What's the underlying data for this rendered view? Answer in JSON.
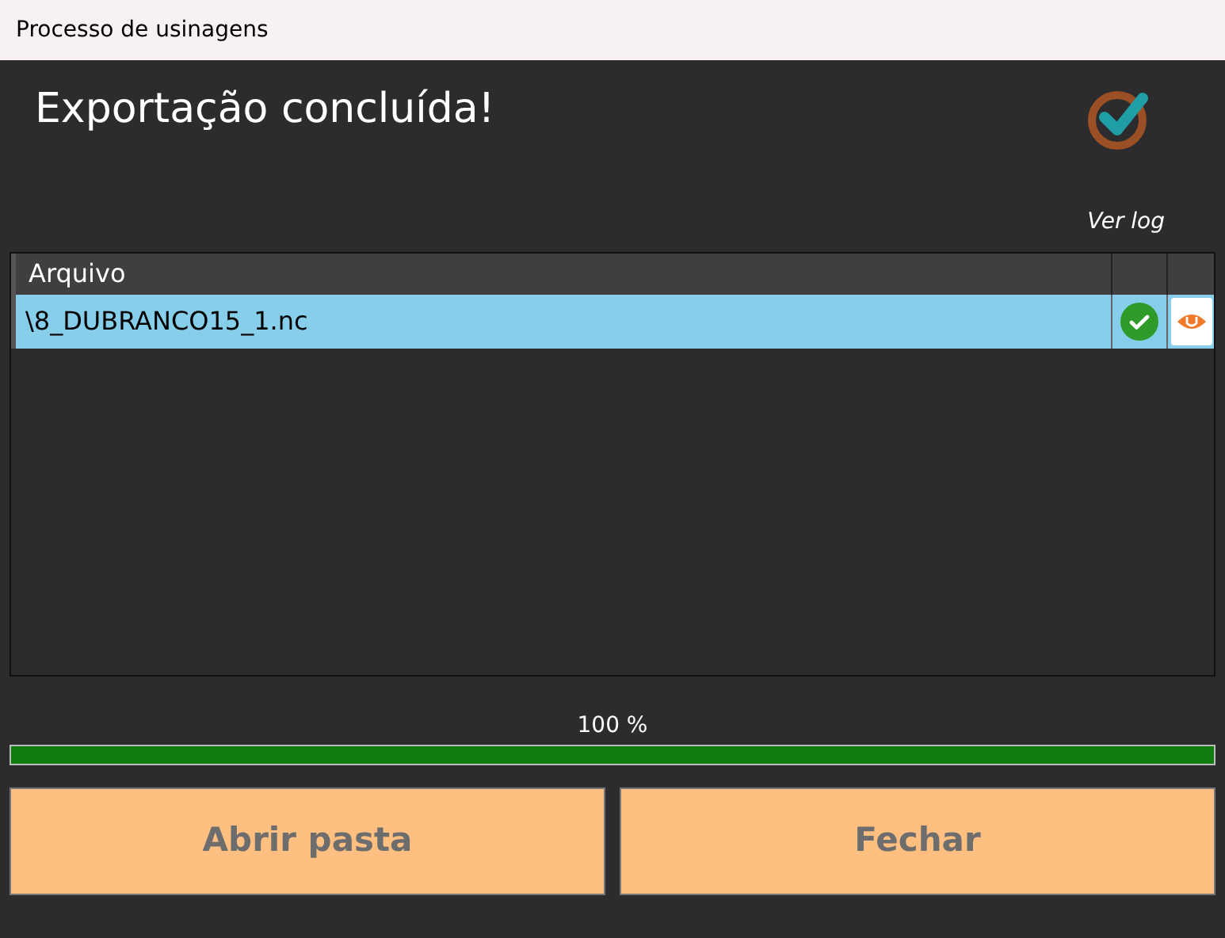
{
  "window": {
    "title": "Processo de usinagens"
  },
  "heading": "Exportação concluída!",
  "view_log_link": "Ver log",
  "table": {
    "columns": [
      "Arquivo"
    ],
    "rows": [
      {
        "file": "\\8_DUBRANCO15_1.nc",
        "selected": true,
        "kind": "success"
      }
    ]
  },
  "progress": {
    "label": "100 %",
    "level": 1
  },
  "buttons": [
    "Abrir pasta",
    "Fechar"
  ]
}
